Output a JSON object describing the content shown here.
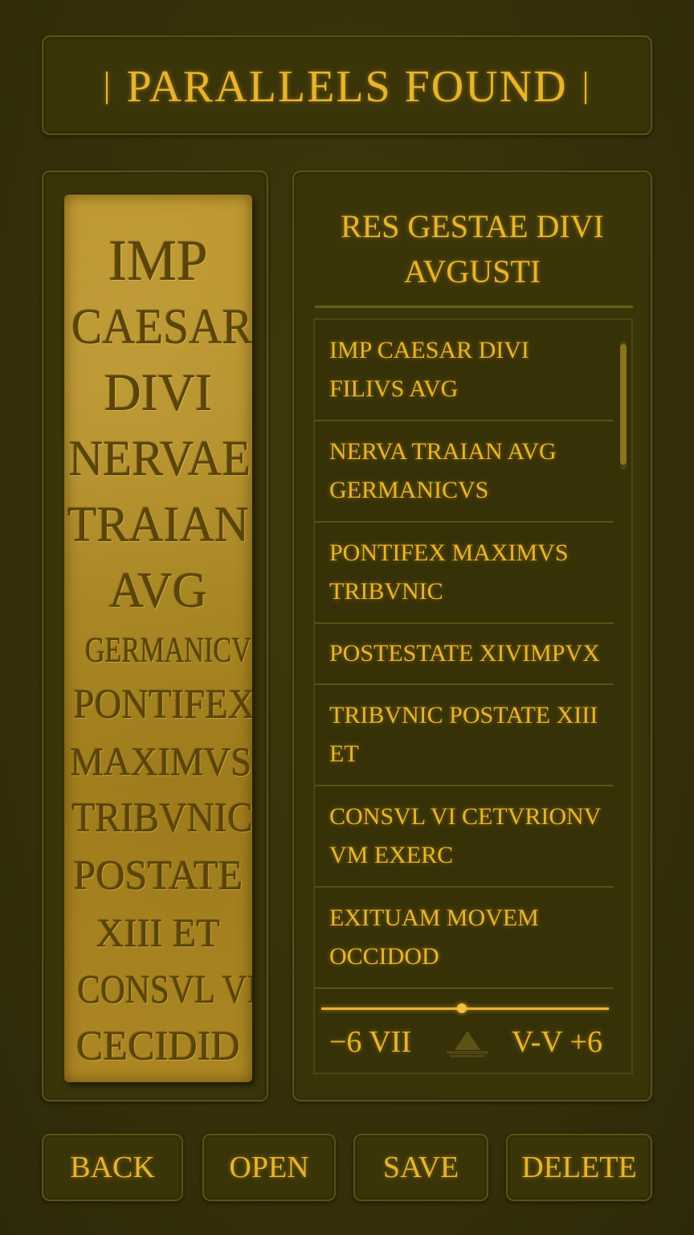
{
  "header": {
    "title": "PARALLELS FOUND"
  },
  "stone": {
    "lines": [
      "IMP",
      "CAESAR",
      "DIVI",
      "NERVAE",
      "TRAIAN",
      "AVG",
      "GERMANICVS",
      "PONTIFEX",
      "MAXIMVS",
      "TRIBVNIC",
      "POSTATE",
      "XIII ET",
      "CONSVL VI",
      "CECIDID"
    ]
  },
  "match": {
    "title": "RES GESTAE DIVI AVGUSTI",
    "items": [
      "IMP CAESAR DIVI FILIVS AVG",
      "NERVA TRAIAN AVG GERMANICVS",
      "PONTIFEX MAXIMVS TRIBVNIC",
      "POSTESTATE XIVIMPVX",
      "TRIBVNIC POSTATE XIII ET",
      "CONSVL VI CETVRIONV VM EXERC",
      "EXITUAM MOVEM OCCIDOD"
    ],
    "range": {
      "left": "−6  VII",
      "right": "V-V +6",
      "slider_position": 0.49
    }
  },
  "buttons": {
    "back": "BACK",
    "open": "OPEN",
    "save": "SAVE",
    "delete": "DELETE"
  },
  "colors": {
    "accent": "#e8b42c",
    "background": "#3b3509",
    "stone": "#b08a25"
  }
}
